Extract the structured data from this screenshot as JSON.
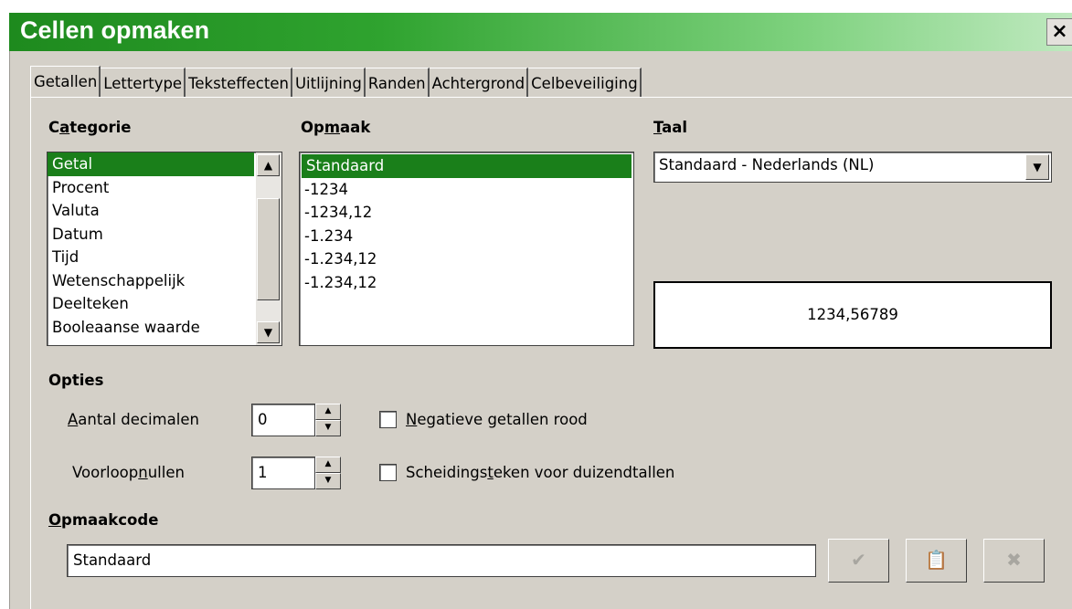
{
  "window": {
    "title": "Cellen opmaken",
    "close_glyph": "×"
  },
  "tabs": [
    {
      "label": "Getallen",
      "active": true
    },
    {
      "label": "Lettertype",
      "active": false
    },
    {
      "label": "Teksteffecten",
      "active": false
    },
    {
      "label": "Uitlijning",
      "active": false
    },
    {
      "label": "Randen",
      "active": false
    },
    {
      "label": "Achtergrond",
      "active": false
    },
    {
      "label": "Celbeveiliging",
      "active": false
    }
  ],
  "category": {
    "label_pre": "C",
    "label_u": "a",
    "label_post": "tegorie",
    "items": [
      "Getal",
      "Procent",
      "Valuta",
      "Datum",
      "Tijd",
      "Wetenschappelijk",
      "Deelteken",
      "Booleaanse waarde"
    ],
    "selected": "Getal"
  },
  "format": {
    "label_pre": "Op",
    "label_u": "m",
    "label_post": "aak",
    "items": [
      "Standaard",
      "-1234",
      "-1234,12",
      "-1.234",
      "-1.234,12",
      "-1.234,12"
    ],
    "selected": "Standaard"
  },
  "language": {
    "label_u": "T",
    "label_post": "aal",
    "value": "Standaard - Nederlands (NL)"
  },
  "preview": {
    "value": "1234,56789"
  },
  "options": {
    "heading": "Opties",
    "decimals": {
      "label_u": "A",
      "label_post": "antal decimalen",
      "value": "0"
    },
    "leading_zeros": {
      "label_pre": "Voorloop",
      "label_u": "n",
      "label_post": "ullen",
      "value": "1"
    },
    "negative_red": {
      "label_u": "N",
      "label_post": "egatieve getallen rood",
      "checked": false
    },
    "thousands_sep": {
      "label_pre": "Scheidings",
      "label_u": "t",
      "label_post": "eken voor duizendtallen",
      "checked": false
    }
  },
  "format_code": {
    "label_u": "O",
    "label_post": "pmaakcode",
    "value": "Standaard"
  },
  "icons": {
    "accept": "checkmark-icon",
    "add_comment": "comment-icon",
    "delete": "delete-icon"
  },
  "colors": {
    "title_green": "#1e8a1e",
    "selection_green": "#1a7f1a",
    "dialog_bg": "#d4d0c8"
  }
}
